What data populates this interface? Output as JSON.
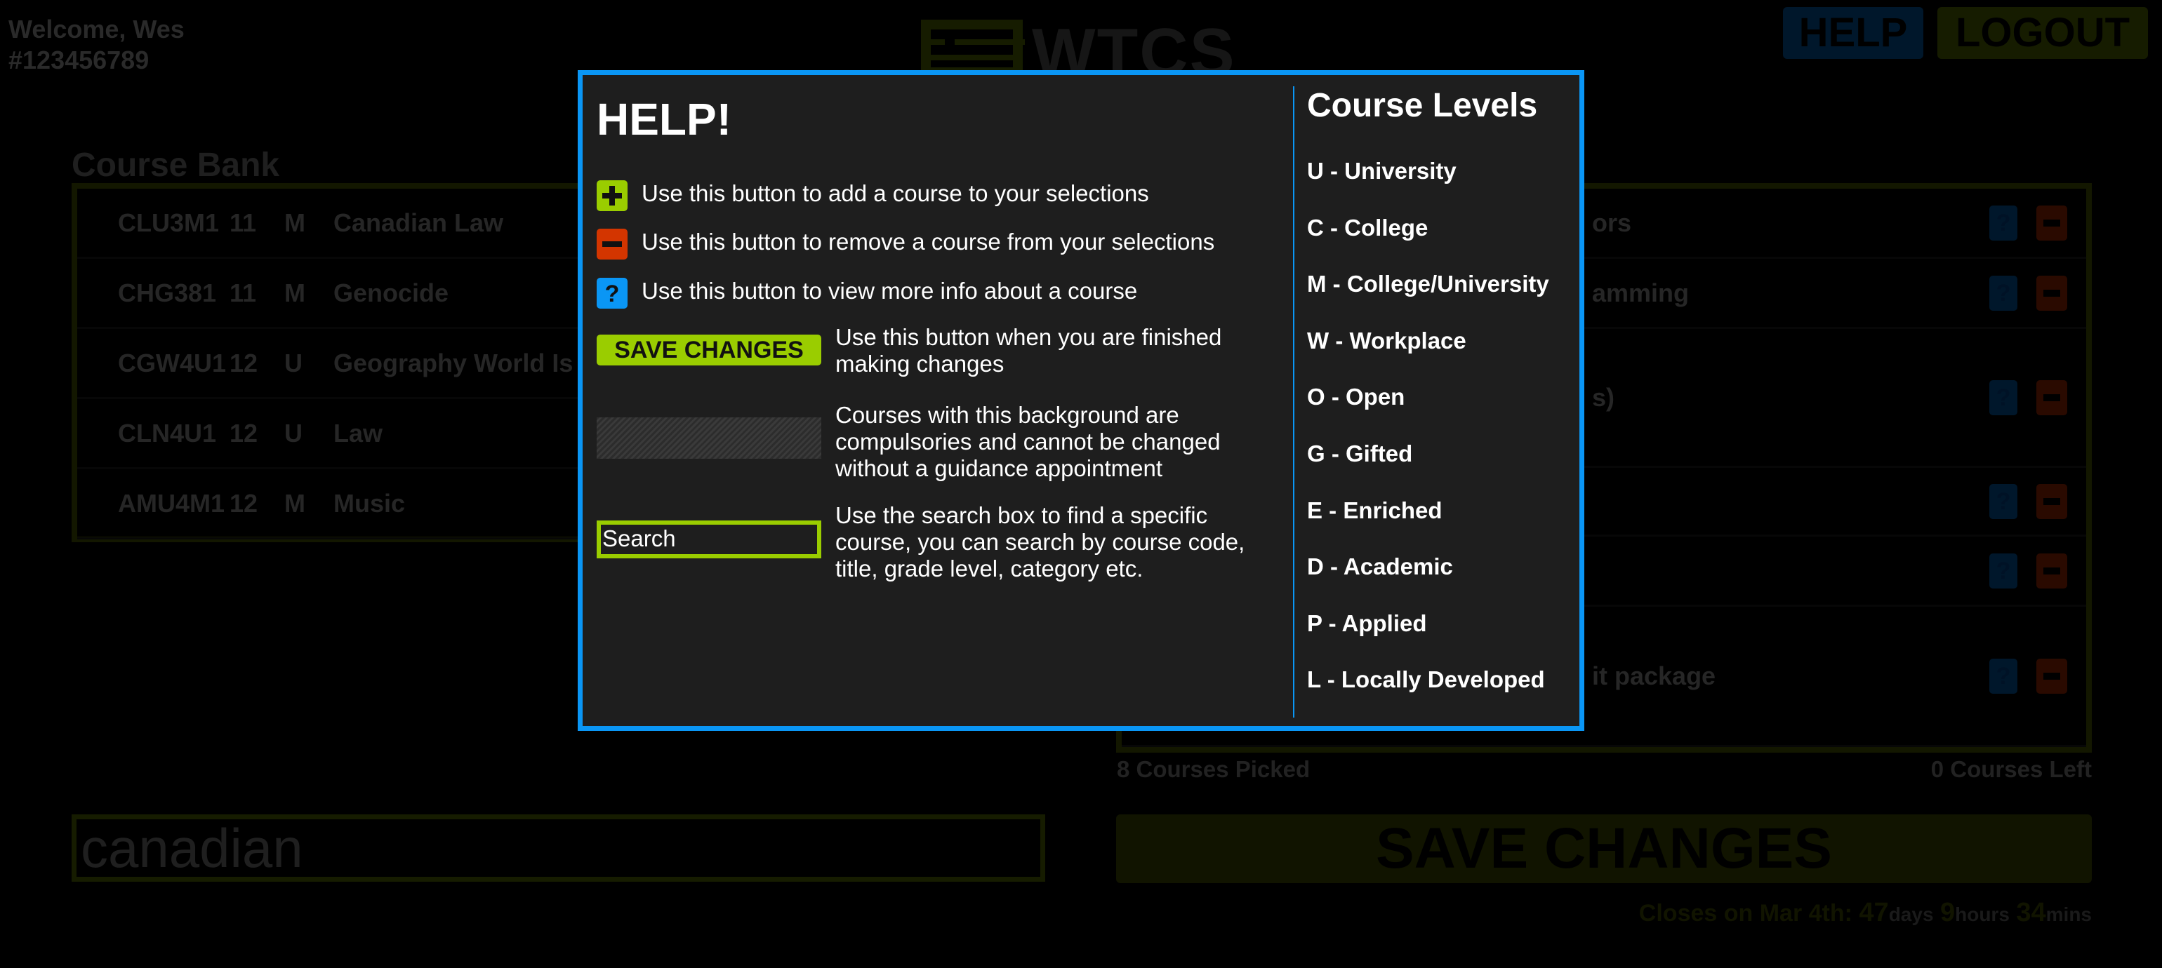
{
  "header": {
    "welcome": "Welcome, Wes",
    "student_number": "#123456789",
    "logo_text": "WTCS",
    "help_label": "HELP",
    "logout_label": "LOGOUT"
  },
  "course_bank": {
    "title": "Course Bank",
    "rows": [
      {
        "code": "CLU3M1",
        "grade": "11",
        "level": "M",
        "title": "Canadian Law"
      },
      {
        "code": "CHG381",
        "grade": "11",
        "level": "M",
        "title": "Genocide"
      },
      {
        "code": "CGW4U1",
        "grade": "12",
        "level": "U",
        "title": "Geography World Is"
      },
      {
        "code": "CLN4U1",
        "grade": "12",
        "level": "U",
        "title": "Law"
      },
      {
        "code": "AMU4M1",
        "grade": "12",
        "level": "M",
        "title": "Music"
      }
    ]
  },
  "selections": {
    "rows": [
      {
        "title_visible": "ors"
      },
      {
        "title_visible": "amming"
      },
      {
        "title_visible": "s)"
      },
      {
        "title_visible": ""
      },
      {
        "title_visible": ""
      },
      {
        "title_visible": "it package"
      }
    ],
    "info_glyph": "?",
    "picked": "8 Courses Picked",
    "left": "0 Courses Left"
  },
  "search": {
    "value": "canadian"
  },
  "save_label": "SAVE CHANGES",
  "deadline": {
    "prefix": "Closes on Mar 4th:",
    "days": "47",
    "days_unit": "days",
    "hours": "9",
    "hours_unit": "hours",
    "mins": "34",
    "mins_unit": "mins"
  },
  "help_modal": {
    "title": "HELP!",
    "items": [
      {
        "icon": "plus-icon",
        "text": "Use this button to add a course to your selections"
      },
      {
        "icon": "minus-icon",
        "text": "Use this button to remove a course from your selections"
      },
      {
        "icon": "question-icon",
        "icon_glyph": "?",
        "text": "Use this button to view more info about a course"
      }
    ],
    "save_demo_label": "SAVE CHANGES",
    "save_desc": "Use this button when you are finished making changes",
    "compulsory_desc": "Courses with this background are compulsories and cannot be changed without a guidance appointment",
    "search_demo_label": "Search",
    "search_desc": "Use the search box to find a specific course, you can search by course code, title, grade level, category etc.",
    "levels_title": "Course Levels",
    "levels": [
      "U - University",
      "C - College",
      "M - College/University",
      "W - Workplace",
      "O - Open",
      "G - Gifted",
      "E - Enriched",
      "D - Academic",
      "P - Applied",
      "L - Locally Developed"
    ]
  },
  "colors": {
    "accent_green": "#9acd00",
    "remove_red": "#d33500",
    "info_blue": "#0a96f5",
    "modal_bg": "#1e1e1e"
  }
}
